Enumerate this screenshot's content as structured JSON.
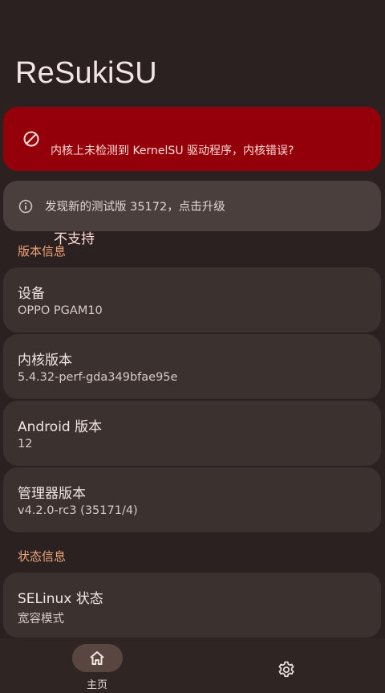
{
  "app": {
    "title": "ReSukiSU"
  },
  "status_card": {
    "title": "不支持",
    "description": "内核上未检测到 KernelSU 驱动程序，内核错误?"
  },
  "update_card": {
    "text": "发现新的测试版 35172，点击升级"
  },
  "sections": {
    "version_info": "版本信息",
    "status_info": "状态信息"
  },
  "info": [
    {
      "label": "设备",
      "value": "OPPO PGAM10"
    },
    {
      "label": "内核版本",
      "value": "5.4.32-perf-gda349bfae95e"
    },
    {
      "label": "Android 版本",
      "value": "12"
    },
    {
      "label": "管理器版本",
      "value": "v4.2.0-rc3 (35171/4)"
    }
  ],
  "status": [
    {
      "label": "SELinux 状态",
      "value": "宽容模式"
    }
  ],
  "nav": {
    "home_label": "主页",
    "home_icon": "home-icon",
    "settings_icon": "gear-icon"
  },
  "colors": {
    "background": "#2a2120",
    "error": "#93000a",
    "accent": "#f0a47c",
    "card": "#3b3230"
  }
}
